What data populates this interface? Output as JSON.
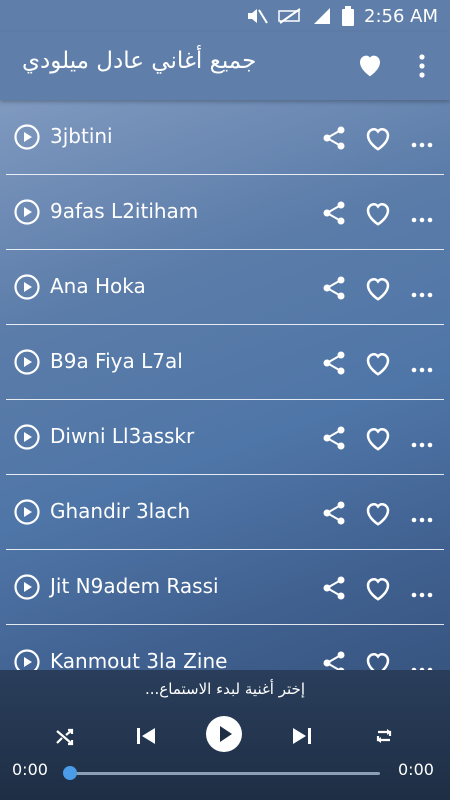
{
  "status_bar": {
    "time": "2:56 AM",
    "icons": [
      "mute-icon",
      "no-data-icon",
      "signal-icon",
      "battery-icon"
    ]
  },
  "app_bar": {
    "title": "جميع أغاني عادل ميلودي",
    "icons": [
      "heart-icon",
      "more-vert-icon"
    ]
  },
  "songs": [
    {
      "title": "3jbtini"
    },
    {
      "title": "9afas L2itiham"
    },
    {
      "title": "Ana Hoka"
    },
    {
      "title": "B9a Fiya L7al"
    },
    {
      "title": "Diwni Ll3asskr"
    },
    {
      "title": "Ghandir 3lach"
    },
    {
      "title": "Jit N9adem Rassi"
    },
    {
      "title": "Kanmout 3la Zine"
    }
  ],
  "player": {
    "prompt": "إختر أغنية لبدء الاستماع...",
    "time_current": "0:00",
    "time_total": "0:00",
    "progress": 0,
    "controls": [
      "shuffle-icon",
      "previous-icon",
      "play-icon",
      "next-icon",
      "repeat-icon"
    ]
  },
  "colors": {
    "bar": "#5f7ea9",
    "player_bg": "#1e2e45",
    "seek_thumb": "#4a9be8"
  }
}
